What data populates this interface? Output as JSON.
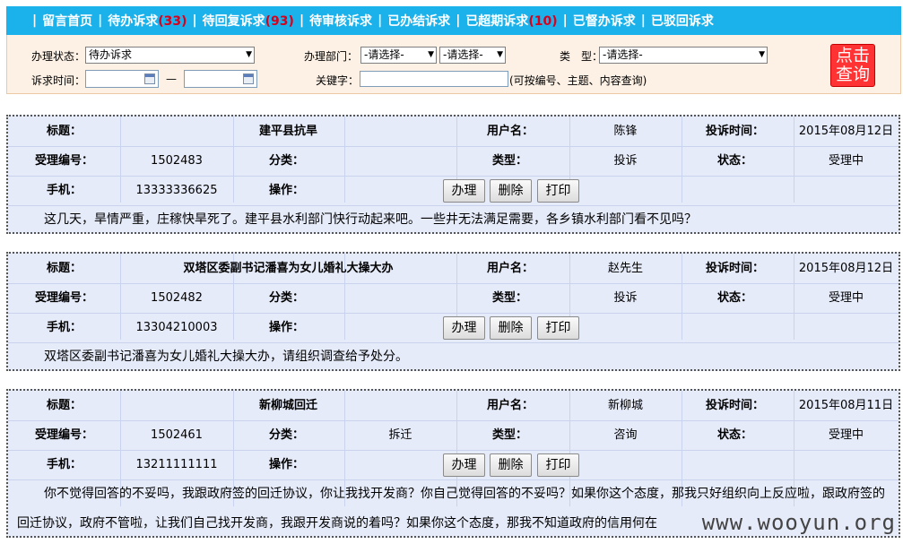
{
  "nav": {
    "items": [
      {
        "label": "留言首页",
        "count": ""
      },
      {
        "label": "待办诉求",
        "count": "(33)"
      },
      {
        "label": "待回复诉求",
        "count": "(93)"
      },
      {
        "label": "待审核诉求",
        "count": ""
      },
      {
        "label": "已办结诉求",
        "count": ""
      },
      {
        "label": "已超期诉求",
        "count": "(10)"
      },
      {
        "label": "已督办诉求",
        "count": ""
      },
      {
        "label": "已驳回诉求",
        "count": ""
      }
    ],
    "separator": "|"
  },
  "filter": {
    "status_label": "办理状态：",
    "status_value": "待办诉求",
    "dept_label": "办理部门：",
    "dept_value1": "-请选择-",
    "dept_value2": "-请选择-",
    "type_label": "类　型：",
    "type_value": "-请选择-",
    "time_label": "诉求时间：",
    "time_dash": "—",
    "keyword_label": "关键字：",
    "keyword_hint": "(可按编号、主题、内容查询)",
    "query_line1": "点击",
    "query_line2": "查询"
  },
  "labels": {
    "title": "标题：",
    "username": "用户名：",
    "time": "投诉时间：",
    "id": "受理编号：",
    "category": "分类：",
    "type": "类型：",
    "status": "状态：",
    "phone": "手机：",
    "action": "操作：",
    "btn_handle": "办理",
    "btn_delete": "删除",
    "btn_print": "打印"
  },
  "complaints": [
    {
      "title": "建平县抗旱",
      "username": "陈锋",
      "time": "2015年08月12日",
      "id": "1502483",
      "category": "",
      "type": "投诉",
      "status": "受理中",
      "phone": "13333336625",
      "content": "这几天，旱情严重，庄稼快旱死了。建平县水利部门快行动起来吧。一些井无法满足需要，各乡镇水利部门看不见吗？"
    },
    {
      "title": "双塔区委副书记潘喜为女儿婚礼大操大办",
      "username": "赵先生",
      "time": "2015年08月12日",
      "id": "1502482",
      "category": "",
      "type": "投诉",
      "status": "受理中",
      "phone": "13304210003",
      "content": "双塔区委副书记潘喜为女儿婚礼大操大办，请组织调查给予处分。"
    },
    {
      "title": "新柳城回迁",
      "username": "新柳城",
      "time": "2015年08月11日",
      "id": "1502461",
      "category": "拆迁",
      "type": "咨询",
      "status": "受理中",
      "phone": "13211111111",
      "content": "你不觉得回答的不妥吗，我跟政府签的回迁协议，你让我找开发商？你自己觉得回答的不妥吗？如果你这个态度，那我只好组织向上反应啦，跟政府签的回迁协议，政府不管啦，让我们自己找开发商，我跟开发商说的着吗？如果你这个态度，那我不知道政府的信用何在"
    }
  ],
  "watermark": "www.wooyun.org"
}
